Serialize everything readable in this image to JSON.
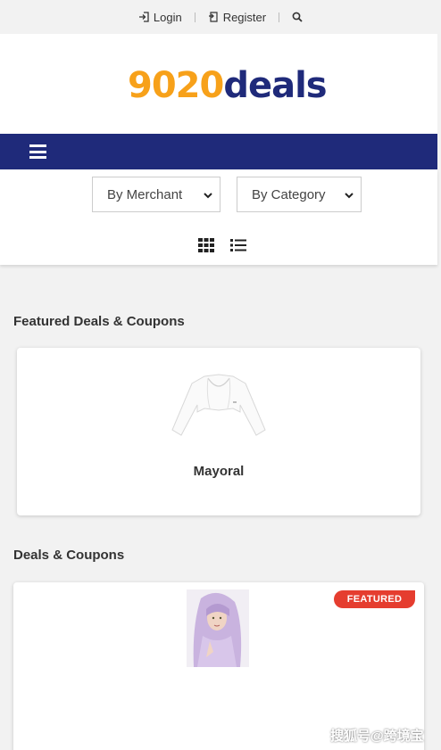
{
  "topbar": {
    "login_label": "Login",
    "register_label": "Register"
  },
  "logo": {
    "number": "9020",
    "text": "deals"
  },
  "filters": {
    "merchant_select": "By Merchant",
    "category_select": "By Category"
  },
  "sections": {
    "featured_title": "Featured Deals & Coupons",
    "deals_title": "Deals & Coupons"
  },
  "featured_card": {
    "merchant": "Mayoral"
  },
  "deal_card": {
    "badge": "FEATURED"
  },
  "watermark": "搜狐号@跨境宝",
  "colors": {
    "navbar": "#1f2a7a",
    "logo_number": "#f7a11a",
    "logo_text": "#1f2a7a",
    "badge": "#e53d2f",
    "page_bg": "#f2f2f2"
  },
  "icons": [
    "login-icon",
    "register-icon",
    "search-icon",
    "menu-icon",
    "grid-view-icon",
    "list-view-icon",
    "chevron-down-icon"
  ]
}
